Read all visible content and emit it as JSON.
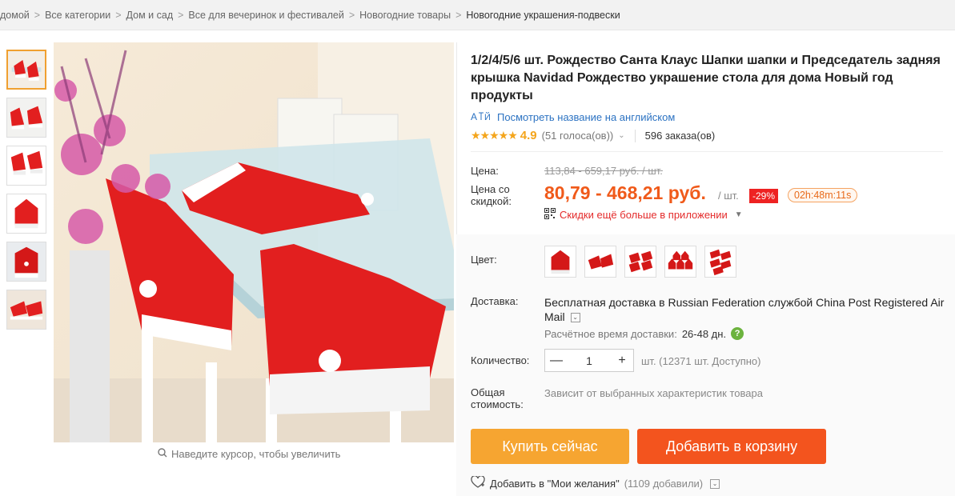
{
  "breadcrumb": {
    "items": [
      "домой",
      "Все категории",
      "Дом и сад",
      "Все для вечеринок и фестивалей",
      "Новогодние товары",
      "Новогодние украшения-подвески"
    ],
    "separator": ">"
  },
  "gallery": {
    "zoom_hint": "Наведите курсор, чтобы увеличить",
    "thumbnail_count": 6
  },
  "product": {
    "title": "1/2/4/5/6 шт. Рождество Санта Клаус Шапки шапки и Председатель задняя крышка Navidad Рождество украшение стола для дома Новый год продукты",
    "translate_link": "Посмотреть название на английском",
    "rating": {
      "stars": "★★★★★",
      "score": "4.9",
      "votes": "(51 голоса(ов))",
      "orders": "596 заказа(ов)"
    },
    "price": {
      "label": "Цена:",
      "old": "113,84 - 659,17 руб. / шт.",
      "discount_label": "Цена со скидкой:",
      "current": "80,79 - 468,21 руб.",
      "unit": "/ шт.",
      "discount_badge": "-29%",
      "timer": "02h:48m:11s"
    },
    "app_promo": "Скидки ещё больше в приложении",
    "color": {
      "label": "Цвет:",
      "options": 5
    },
    "delivery": {
      "label": "Доставка:",
      "prefix": "Бесплатная доставка",
      "middle": "в Russian Federation службой China Post Registered Air Mail",
      "eta_label": "Расчётное время доставки:",
      "eta_value": "26-48 дн."
    },
    "quantity": {
      "label": "Количество:",
      "minus": "—",
      "value": "1",
      "plus": "+",
      "stock": "шт. (12371 шт. Доступно)"
    },
    "total": {
      "label": "Общая стоимость:",
      "value": "Зависит от выбранных характеристик товара"
    },
    "buttons": {
      "buy": "Купить сейчас",
      "cart": "Добавить в корзину"
    },
    "wishlist": {
      "label": "Добавить в \"Мои желания\"",
      "count": "(1109 добавили)"
    }
  },
  "colors": {
    "accent_orange": "#f05a1a",
    "buy_button": "#f6a531",
    "cart_button": "#f3541e",
    "link_blue": "#2b72c2",
    "star": "#f4a51c"
  }
}
